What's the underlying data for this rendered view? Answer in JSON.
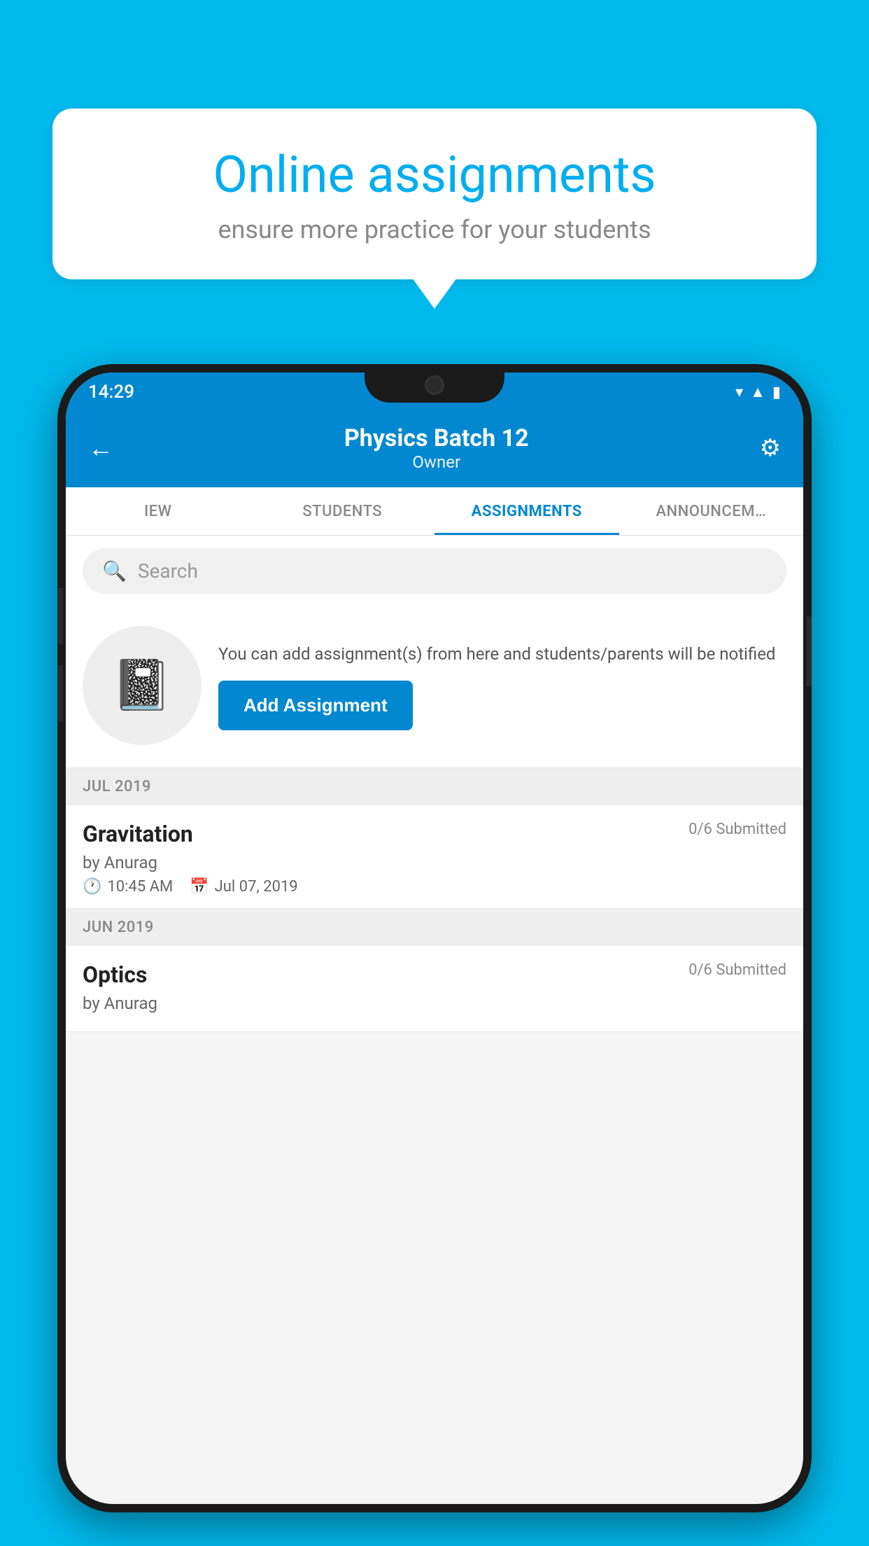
{
  "background_color": "#00BAED",
  "speech_bubble": {
    "title": "Online assignments",
    "subtitle": "ensure more practice for your students"
  },
  "phone": {
    "status_bar": {
      "time": "14:29",
      "icons": [
        "wifi",
        "signal",
        "battery"
      ]
    },
    "header": {
      "title": "Physics Batch 12",
      "subtitle": "Owner",
      "back_label": "←",
      "settings_label": "⚙"
    },
    "tabs": [
      {
        "label": "IEW",
        "active": false
      },
      {
        "label": "STUDENTS",
        "active": false
      },
      {
        "label": "ASSIGNMENTS",
        "active": true
      },
      {
        "label": "ANNOUNCEM…",
        "active": false
      }
    ],
    "search": {
      "placeholder": "Search"
    },
    "promo": {
      "description": "You can add assignment(s) from here and students/parents will be notified",
      "button_label": "Add Assignment"
    },
    "sections": [
      {
        "header": "JUL 2019",
        "assignments": [
          {
            "name": "Gravitation",
            "submitted": "0/6 Submitted",
            "author": "by Anurag",
            "time": "10:45 AM",
            "date": "Jul 07, 2019"
          }
        ]
      },
      {
        "header": "JUN 2019",
        "assignments": [
          {
            "name": "Optics",
            "submitted": "0/6 Submitted",
            "author": "by Anurag",
            "time": "",
            "date": ""
          }
        ]
      }
    ]
  }
}
